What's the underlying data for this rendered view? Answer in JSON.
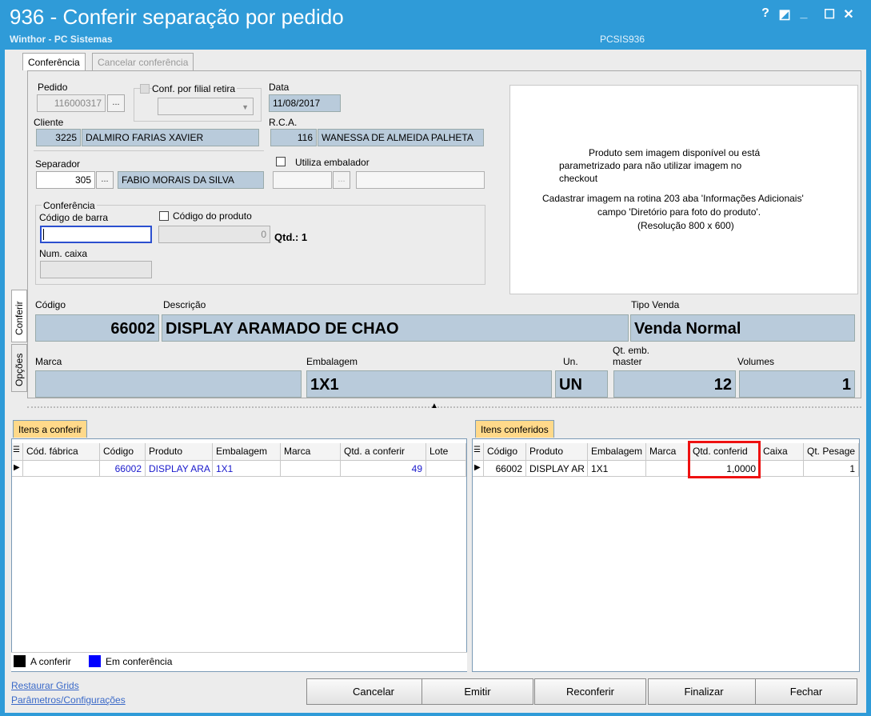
{
  "window": {
    "title": "936 - Conferir separação por pedido",
    "subtitle": "Winthor - PC Sistemas",
    "code": "PCSIS936",
    "ctrl_help": "?",
    "ctrl_restore": "◩",
    "ctrl_min": "_",
    "ctrl_max": "☐",
    "ctrl_close": "✕"
  },
  "tabs": {
    "active": "Conferência",
    "inactive": "Cancelar conferência"
  },
  "side_tabs": {
    "conferir": "Conferir",
    "opcoes": "Opções"
  },
  "pedido": {
    "label": "Pedido",
    "value": "116000317",
    "btn": "..."
  },
  "filial": {
    "label": "Conf. por filial retira"
  },
  "data": {
    "label": "Data",
    "value": "11/08/2017"
  },
  "cliente": {
    "label": "Cliente",
    "code": "3225",
    "name": "DALMIRO FARIAS XAVIER"
  },
  "rca": {
    "label": "R.C.A.",
    "code": "116",
    "name": "WANESSA DE ALMEIDA PALHETA"
  },
  "separador": {
    "label": "Separador",
    "code": "305",
    "btn": "...",
    "name": "FABIO MORAIS DA SILVA"
  },
  "embalador": {
    "label": "Utiliza embalador",
    "btn": "..."
  },
  "conferencia": {
    "group_label": "Conferência",
    "barcode_label": "Código de barra",
    "barcode_value": "",
    "codprod_label": "Código do produto",
    "codprod_value": "0",
    "qtd_label": "Qtd.: 1",
    "caixa_label": "Num. caixa"
  },
  "image_msg": {
    "line1": "Produto sem imagem disponível ou está",
    "line2": "parametrizado para não utilizar imagem no",
    "line3": "checkout",
    "line4": "Cadastrar imagem na rotina 203 aba 'Informações Adicionais'",
    "line5": "campo 'Diretório para foto do produto'.",
    "line6": "(Resolução 800 x 600)"
  },
  "produto": {
    "codigo_label": "Código",
    "codigo": "66002",
    "descricao_label": "Descrição",
    "descricao": "DISPLAY ARAMADO DE CHAO",
    "tipo_label": "Tipo Venda",
    "tipo": "Venda Normal",
    "marca_label": "Marca",
    "marca": "",
    "embalagem_label": "Embalagem",
    "embalagem": "1X1",
    "un_label": "Un.",
    "un": "UN",
    "qtmaster_label1": "Qt. emb.",
    "qtmaster_label2": "master",
    "qtmaster": "12",
    "volumes_label": "Volumes",
    "volumes": "1"
  },
  "grid_left": {
    "tab": "Itens a conferir",
    "headers": [
      "Cód. fábrica",
      "Código",
      "Produto",
      "Embalagem",
      "Marca",
      "Qtd. a conferir",
      "Lote"
    ],
    "rows": [
      [
        "",
        "66002",
        "DISPLAY ARA",
        "1X1",
        "",
        "49",
        ""
      ]
    ]
  },
  "grid_right": {
    "tab": "Itens conferidos",
    "headers": [
      "Código",
      "Produto",
      "Embalagem",
      "Marca",
      "Qtd. conferid",
      "Caixa",
      "Qt. Pesage"
    ],
    "rows": [
      [
        "66002",
        "DISPLAY AR",
        "1X1",
        "",
        "1,0000",
        "",
        "1"
      ]
    ]
  },
  "legend": {
    "a_conferir": "A conferir",
    "em_conferencia": "Em conferência",
    "color_a": "#000000",
    "color_em": "#0000ff"
  },
  "links": {
    "restaurar": "Restaurar Grids",
    "parametros": "Parâmetros/Configurações"
  },
  "buttons": {
    "cancelar": "Cancelar",
    "emitir": "Emitir",
    "reconferir": "Reconferir",
    "finalizar": "Finalizar",
    "fechar": "Fechar"
  },
  "colors": {
    "titlebar": "#2f9bd8",
    "field_bg": "#b9cbdb",
    "highlight": "#e11"
  }
}
